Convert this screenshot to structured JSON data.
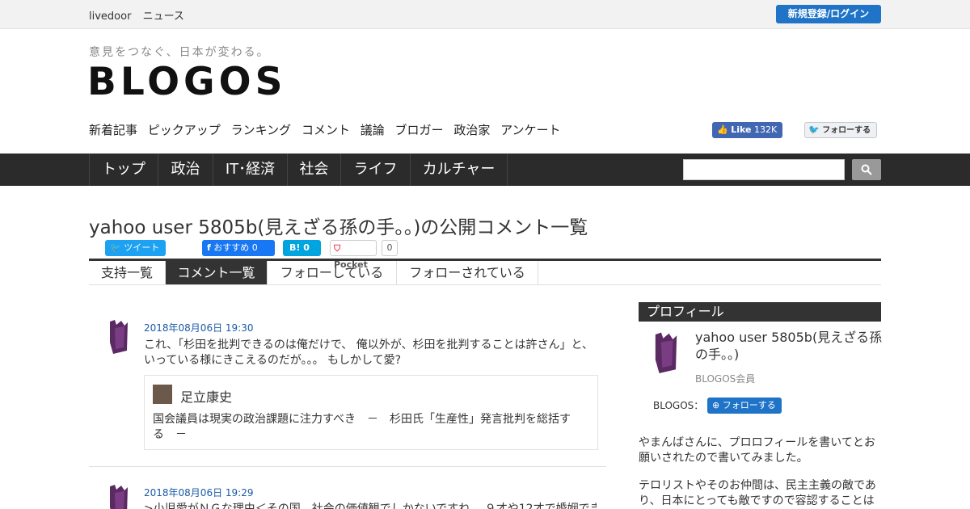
{
  "topbar": {
    "brand": "livedoor",
    "section": "ニュース",
    "login_label": "新規登録/ログイン"
  },
  "header": {
    "tagline": "意見をつなぐ、日本が変わる。",
    "logo": "BLOGOS",
    "subnav": [
      "新着記事",
      "ピックアップ",
      "ランキング",
      "コメント",
      "議論",
      "ブロガー",
      "政治家",
      "アンケート"
    ],
    "fb_like_label": "Like",
    "fb_like_count": "132K",
    "tw_follow_label": "フォローする"
  },
  "mainnav": {
    "items": [
      "トップ",
      "政治",
      "IT･経済",
      "社会",
      "ライフ",
      "カルチャー"
    ]
  },
  "search": {
    "placeholder": ""
  },
  "page": {
    "title": "yahoo user 5805b(見えざる孫の手。。)の公開コメント一覧",
    "share": {
      "tweet": "ツイート",
      "fb": "おすすめ 0",
      "hatena": "B! 0",
      "pocket": "Pocket",
      "pocket_count": "0"
    },
    "tabs": [
      "支持一覧",
      "コメント一覧",
      "フォローしている",
      "フォローされている"
    ],
    "active_tab": "コメント一覧"
  },
  "comments": [
    {
      "date": "2018年08月06日 19:30",
      "text": "これ、「杉田を批判できるのは俺だけで、 俺以外が、杉田を批判することは許さん」と、いっている様にきこえるのだが。。。 もしかして愛?",
      "quote": {
        "author": "足立康史",
        "title": "国会議員は現実の政治課題に注力すべき　－　杉田氏「生産性」発言批判を総括する　－"
      }
    },
    {
      "date": "2018年08月06日 19:29",
      "text": ">小児愛がＮＧな理由＜その国、社会の価値観でしかないですね。 ９才や12才で婚姻でき"
    }
  ],
  "sidebar": {
    "heading": "プロフィール",
    "name": "yahoo user 5805b(見えざる孫の手。。)",
    "role": "BLOGOS会員",
    "blogos_label": "BLOGOS：",
    "follow_label": "フォローする",
    "bio": [
      "やまんばさんに、プロロフィールを書いてとお願いされたので書いてみました。",
      "テロリストやそのお仲間は、民主主義の敵であり、日本にとっても敵ですので容認することは"
    ]
  },
  "colors": {
    "accent": "#1f74c8",
    "nav_bg": "#2b2b2b",
    "avatar": "#5b2a63"
  }
}
